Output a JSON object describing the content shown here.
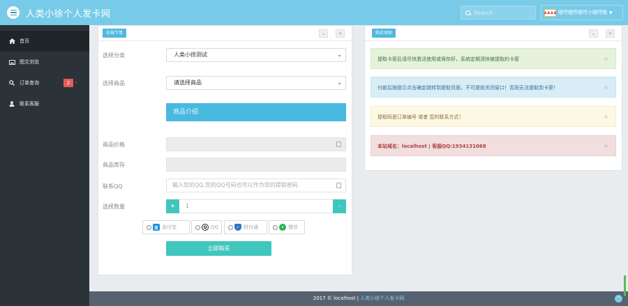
{
  "header": {
    "brand": "人类小徐个人发卡网",
    "search_placeholder": "Search",
    "user_logo_text": "A.B.A.B",
    "user_name": "嗯哼嗯哼嗯哼小嗯哼嗯"
  },
  "sidebar": {
    "items": [
      {
        "label": "首页",
        "icon": "home-icon"
      },
      {
        "label": "图文浏览",
        "icon": "image-icon"
      },
      {
        "label": "订单查询",
        "icon": "search-icon",
        "badge": "2"
      },
      {
        "label": "联系客服",
        "icon": "user-icon"
      }
    ]
  },
  "order_panel": {
    "tag": "在线下单",
    "labels": {
      "category": "选择分类",
      "product": "选择商品",
      "price": "商品价格",
      "stock": "商品库存",
      "contact": "联系QQ",
      "quantity": "选择数量"
    },
    "category_value": "人类小徐测试",
    "product_value": "请选择商品",
    "intro_label": "商品介绍",
    "contact_placeholder": "输入您的QQ,您的QQ号码也可以作为您的提取密码",
    "quantity_value": "1",
    "minus": "-",
    "plus": "+",
    "pay_methods": [
      {
        "label": "支付宝",
        "icon": "alipay-icon",
        "color": "#1a8fe0"
      },
      {
        "label": "QQ",
        "icon": "qq-icon",
        "color": "#222222"
      },
      {
        "label": "财付通",
        "icon": "tenpay-icon",
        "color": "#2b76c2"
      },
      {
        "label": "微信",
        "icon": "wechat-icon",
        "color": "#2bb24c"
      }
    ],
    "buy_label": "立即购买"
  },
  "notice_panel": {
    "tag": "购买须知",
    "alerts": [
      {
        "text": "提取卡密后请尽快激活使用或保存好，系统定期清除被提取的卡密",
        "style": "a-green"
      },
      {
        "text": "付款后按提示点击确定跳转到提取页面，不可提前关闭窗口！否则无法提取到卡密！",
        "style": "a-blue"
      },
      {
        "text": "提取码是订单编号 或者 您的联系方式！",
        "style": "a-yellow"
      },
      {
        "text": "本站域名：localhost | 客服QQ:1934131068",
        "style": "a-red"
      }
    ]
  },
  "footer": {
    "prefix": "2017 © localhost | ",
    "link": "人类小徐个人发卡网"
  },
  "colors": {
    "header": "#78cbe8",
    "sidebar": "#2c3338",
    "accent_teal": "#41c6be",
    "accent_blue": "#49b9e0"
  }
}
